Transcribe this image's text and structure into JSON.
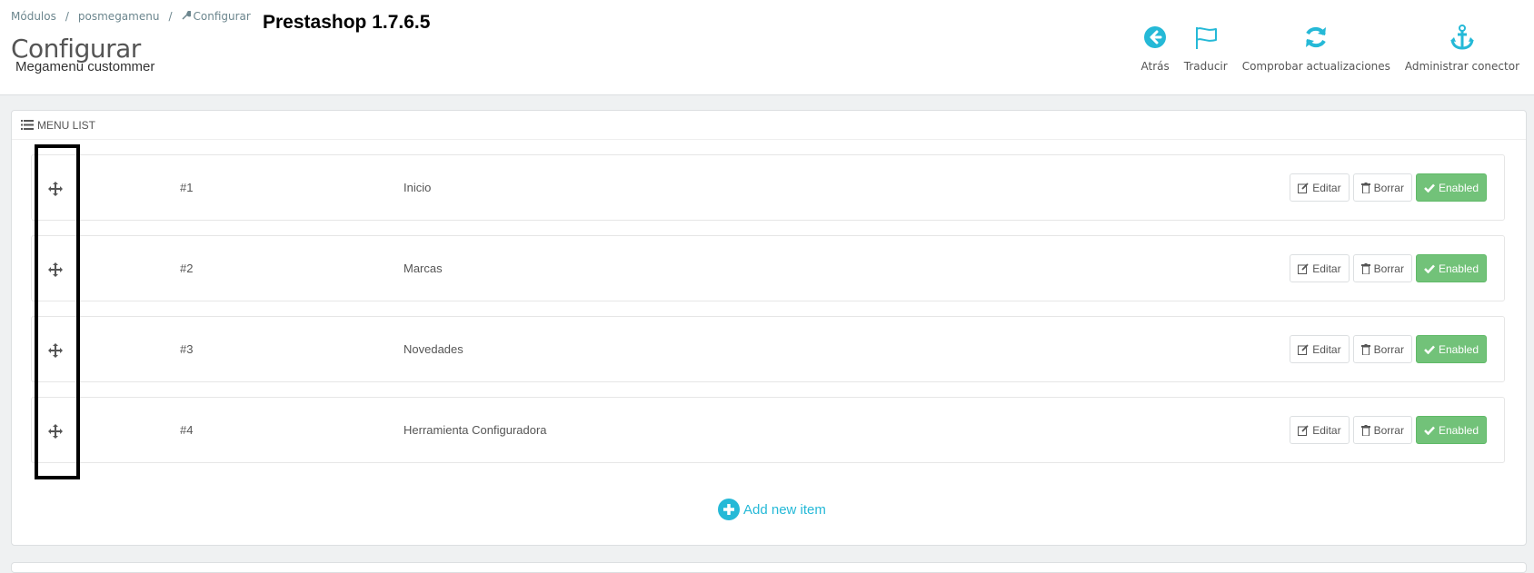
{
  "breadcrumb": {
    "item1": "Módulos",
    "item2": "posmegamenu",
    "item3": "Configurar",
    "separator": "/"
  },
  "page": {
    "title": "Configurar",
    "subtitle": "Megamenu custommer",
    "version_note": "Prestashop 1.7.6.5"
  },
  "toolbar": {
    "back": "Atrás",
    "translate": "Traducir",
    "check_updates": "Comprobar actualizaciones",
    "manage_hooks": "Administrar conector"
  },
  "panel": {
    "heading": "MENU LIST"
  },
  "menu_items": [
    {
      "num": "#1",
      "name": "Inicio",
      "edit": "Editar",
      "delete": "Borrar",
      "status": "Enabled"
    },
    {
      "num": "#2",
      "name": "Marcas",
      "edit": "Editar",
      "delete": "Borrar",
      "status": "Enabled"
    },
    {
      "num": "#3",
      "name": "Novedades",
      "edit": "Editar",
      "delete": "Borrar",
      "status": "Enabled"
    },
    {
      "num": "#4",
      "name": "Herramienta Configuradora",
      "edit": "Editar",
      "delete": "Borrar",
      "status": "Enabled"
    }
  ],
  "add_item": "Add new item",
  "colors": {
    "accent": "#25b9d7",
    "enabled": "#72c279",
    "highlight": "#000000"
  }
}
